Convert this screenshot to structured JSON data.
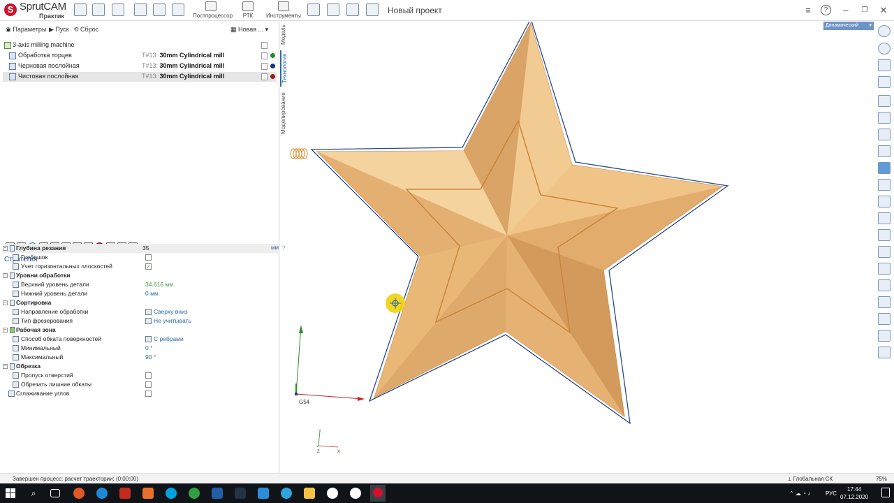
{
  "app": {
    "logo_name": "SprutCAM",
    "logo_edition": "Практик",
    "project_title": "Новый проект"
  },
  "toolbar": {
    "postprocessor_label": "Постпроцессор",
    "rtk_label": "РТК",
    "instruments_label": "Инструменты"
  },
  "subbar": {
    "params_label": "Параметры",
    "run_label": "Пуск",
    "reset_label": "Сброс",
    "new_label": "Новая ..."
  },
  "side_tabs": [
    "Модель",
    "Технология",
    "Моделирование"
  ],
  "ops": {
    "machine": "3-axis milling machine",
    "items": [
      {
        "name": "Обработка торцев",
        "tool_num": "T#13:",
        "tool_name": "30mm Cylindrical mill",
        "dot": "#1f8c2c"
      },
      {
        "name": "Черновая послойная",
        "tool_num": "T#13:",
        "tool_name": "30mm Cylindrical mill",
        "dot": "#1b2f8a"
      },
      {
        "name": "Чистовая послойная",
        "tool_num": "T#13:",
        "tool_name": "30mm Cylindrical mill",
        "dot": "#9a1a1a"
      }
    ]
  },
  "strategy": {
    "title": "Стратегия",
    "props": [
      {
        "label": "Глубина резания",
        "value": "35",
        "unit": "мм",
        "help": "?"
      },
      {
        "label": "Гребешок"
      },
      {
        "label": "Учет горизонтальных плоскостей",
        "check": "✓"
      },
      {
        "label": "Уровни обработки"
      },
      {
        "label": "Верхний уровень детали",
        "value": "34.616 мм"
      },
      {
        "label": "Нижний уровень детали",
        "value": "0 мм"
      },
      {
        "label": "Сортировка"
      },
      {
        "label": "Направление обработки",
        "value": "Сверху вниз"
      },
      {
        "label": "Тип фрезерования",
        "value": "Не учитывать"
      },
      {
        "label": "Рабочая зона"
      },
      {
        "label": "Способ обката поверхностей",
        "value": "С ребрами"
      },
      {
        "label": "Минимальный",
        "value": "0 °"
      },
      {
        "label": "Максимальный",
        "value": "90 °"
      },
      {
        "label": "Обрезка"
      },
      {
        "label": "Пропуск отверстий"
      },
      {
        "label": "Обрезать лишние обкаты"
      },
      {
        "label": "Сглаживание углов"
      }
    ]
  },
  "viewport": {
    "view_mode": "Динамический",
    "csys_label": "G54",
    "axis_x": "X",
    "axis_y": "Y",
    "axis_z": "Z",
    "star_color": "#e8b678",
    "outline_color": "#2a4a8a"
  },
  "status": {
    "message": "Завершен процесс: расчет траектории: (0:00:00)",
    "csys": "Глобальная СК",
    "zoom": "75%"
  },
  "taskbar": {
    "lang": "РУС",
    "time": "17:44",
    "date": "07.12.2020"
  }
}
